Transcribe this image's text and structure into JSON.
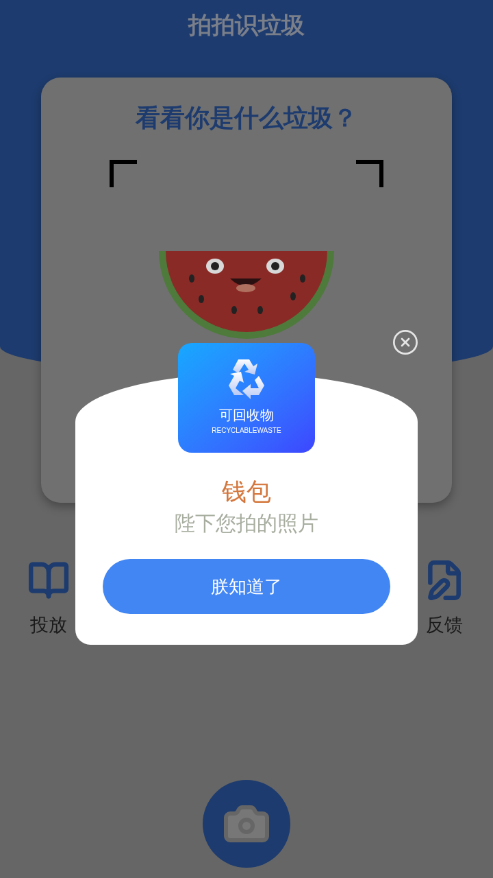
{
  "app_title": "拍拍识垃圾",
  "scan_card": {
    "title": "看看你是什么垃圾？"
  },
  "shortcuts": [
    {
      "kind": "guide",
      "label": "投放"
    },
    {
      "kind": "feedback",
      "label": "反馈"
    }
  ],
  "result_dialog": {
    "category": {
      "name": "可回收物",
      "name_en": "RECYCLABLEWASTE"
    },
    "item": "钱包",
    "subtitle": "陛下您拍的照片",
    "confirm_button": "朕知道了"
  }
}
